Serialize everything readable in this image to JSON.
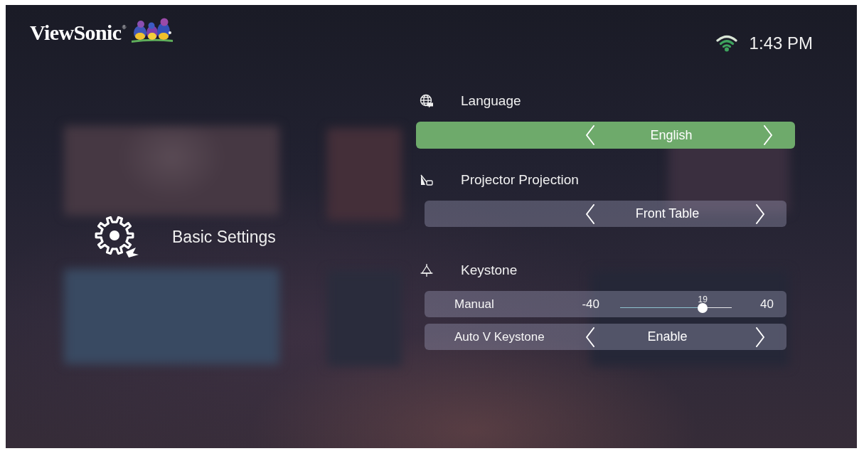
{
  "header": {
    "brand": "ViewSonic$^{®}$",
    "time": "1:43 PM"
  },
  "category": {
    "label": "Basic Settings"
  },
  "sections": [
    {
      "title": "Language",
      "rows": [
        {
          "kind": "selector",
          "value": "English",
          "selected": true
        }
      ]
    },
    {
      "title": "Projector Projection",
      "rows": [
        {
          "kind": "selector",
          "value": "Front Table",
          "selected": false
        }
      ]
    },
    {
      "title": "Keystone",
      "rows": [
        {
          "kind": "slider",
          "label": "Manual",
          "min": "-40",
          "max": "40",
          "reading": "19",
          "level": 0.74,
          "selected": false
        },
        {
          "kind": "selector",
          "label": "Auto V Keystone",
          "value": "Enable",
          "selected": false
        }
      ]
    }
  ]
}
